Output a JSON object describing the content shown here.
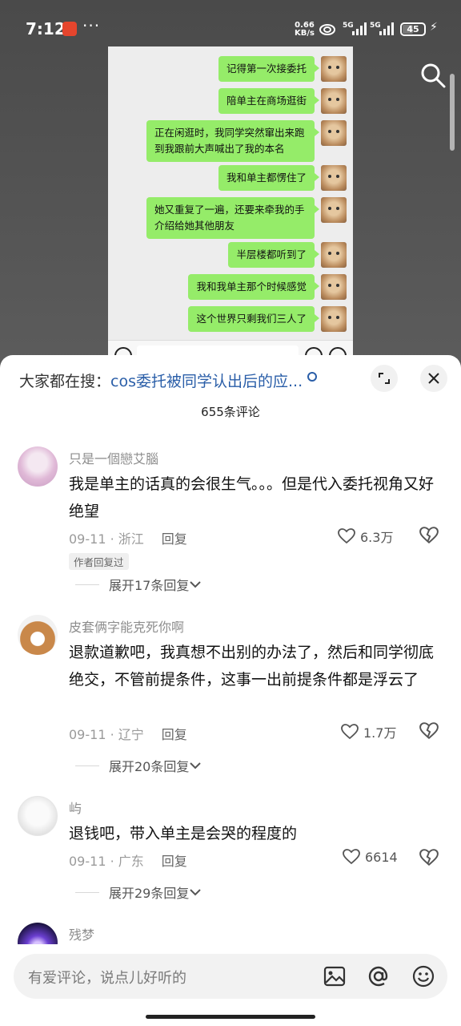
{
  "status_bar": {
    "time": "7:12",
    "dots": "···",
    "net_speed_top": "0.66",
    "net_speed_unit": "KB/s",
    "sig1": "5G",
    "sig2": "5G",
    "battery": "45"
  },
  "chat": {
    "messages": [
      "记得第一次接委托",
      "陪单主在商场逛街",
      "正在闲逛时，我同学突然窜出来跑到我跟前大声喊出了我的本名",
      "我和单主都愣住了",
      "她又重复了一遍，还要来牵我的手介绍给她其他朋友",
      "半层楼都听到了",
      "我和我单主那个时候感觉",
      "这个世界只剩我们三人了"
    ]
  },
  "sheet": {
    "hot_prefix": "大家都在搜：",
    "hot_query": "cos委托被同学认出后的应...",
    "comment_count": "655条评论",
    "comments": [
      {
        "name": "只是一個戀艾腦",
        "text": "我是单主的话真的会很生气。。。但是代入委托视角又好绝望",
        "date": "09-11",
        "location": "浙江",
        "reply": "回复",
        "likes": "6.3万",
        "tag": "作者回复过",
        "expand": "展开17条回复"
      },
      {
        "name": "皮套俩字能克死你啊",
        "text": "退款道歉吧，我真想不出别的办法了，然后和同学彻底绝交，不管前提条件，这事一出前提条件都是浮云了",
        "date": "09-11",
        "location": "辽宁",
        "reply": "回复",
        "likes": "1.7万",
        "expand": "展开20条回复"
      },
      {
        "name": "屿",
        "text": "退钱吧，带入单主是会哭的程度的",
        "date": "09-11",
        "location": "广东",
        "reply": "回复",
        "likes": "6614",
        "expand": "展开29条回复"
      },
      {
        "name": "残梦"
      }
    ],
    "input_placeholder": "有爱评论，说点儿好听的"
  }
}
